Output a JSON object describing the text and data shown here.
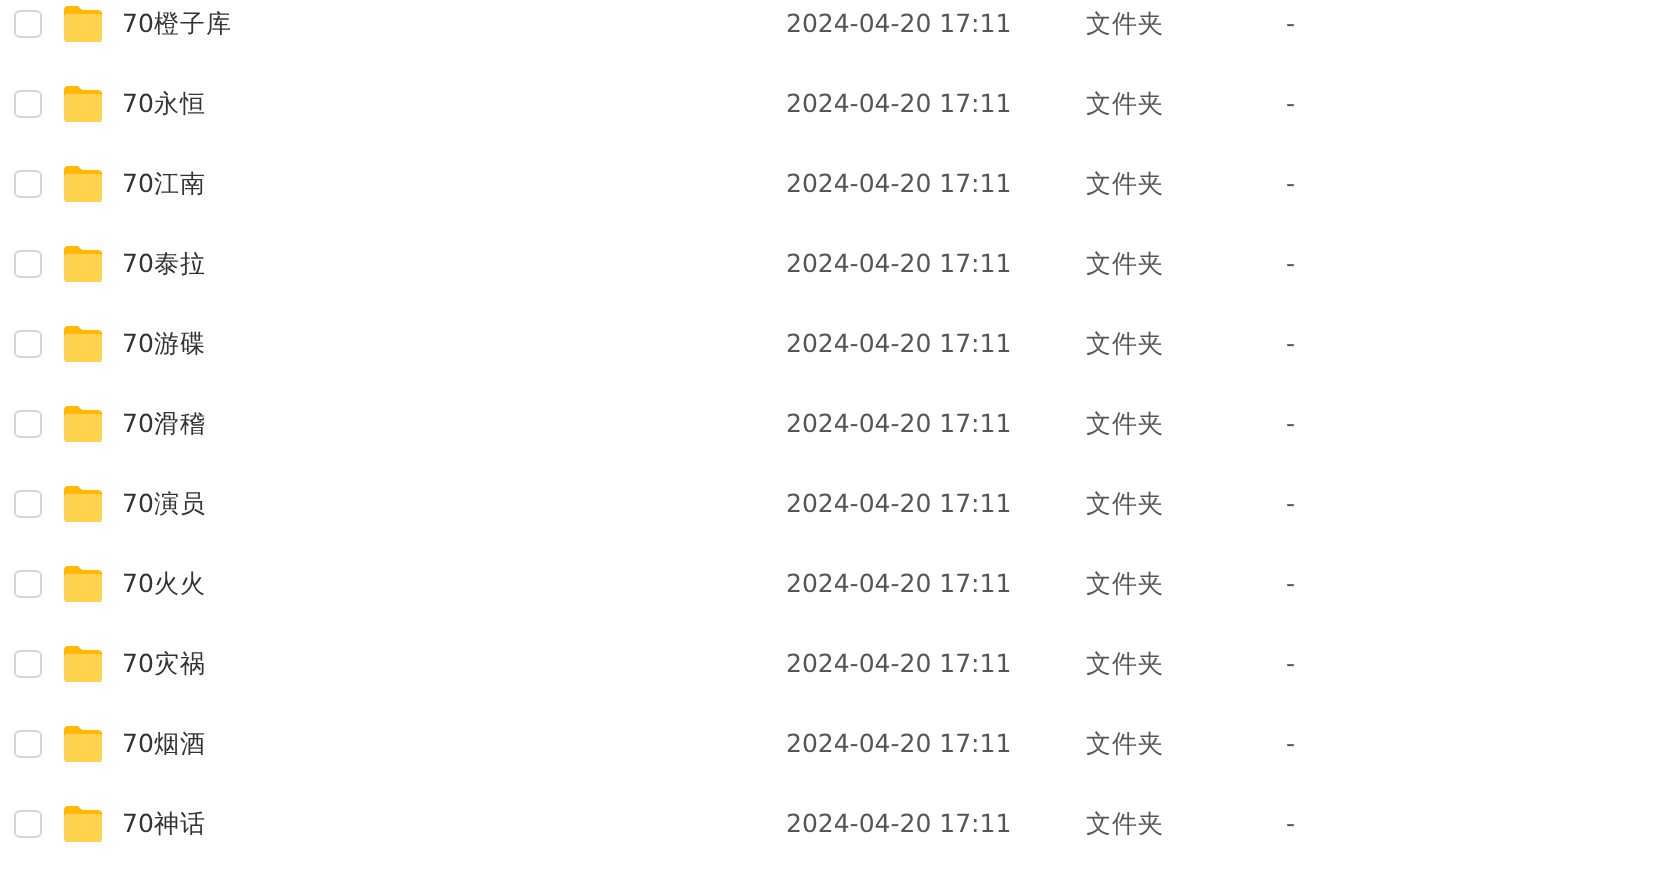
{
  "rows": [
    {
      "name": "70橙子库",
      "modified": "2024-04-20 17:11",
      "type": "文件夹",
      "size": "-",
      "checked": false
    },
    {
      "name": "70永恒",
      "modified": "2024-04-20 17:11",
      "type": "文件夹",
      "size": "-",
      "checked": false
    },
    {
      "name": "70江南",
      "modified": "2024-04-20 17:11",
      "type": "文件夹",
      "size": "-",
      "checked": false
    },
    {
      "name": "70泰拉",
      "modified": "2024-04-20 17:11",
      "type": "文件夹",
      "size": "-",
      "checked": false
    },
    {
      "name": "70游碟",
      "modified": "2024-04-20 17:11",
      "type": "文件夹",
      "size": "-",
      "checked": false
    },
    {
      "name": "70滑稽",
      "modified": "2024-04-20 17:11",
      "type": "文件夹",
      "size": "-",
      "checked": false
    },
    {
      "name": "70演员",
      "modified": "2024-04-20 17:11",
      "type": "文件夹",
      "size": "-",
      "checked": false
    },
    {
      "name": "70火火",
      "modified": "2024-04-20 17:11",
      "type": "文件夹",
      "size": "-",
      "checked": false
    },
    {
      "name": "70灾祸",
      "modified": "2024-04-20 17:11",
      "type": "文件夹",
      "size": "-",
      "checked": false
    },
    {
      "name": "70烟酒",
      "modified": "2024-04-20 17:11",
      "type": "文件夹",
      "size": "-",
      "checked": false
    },
    {
      "name": "70神话",
      "modified": "2024-04-20 17:11",
      "type": "文件夹",
      "size": "-",
      "checked": false
    }
  ]
}
